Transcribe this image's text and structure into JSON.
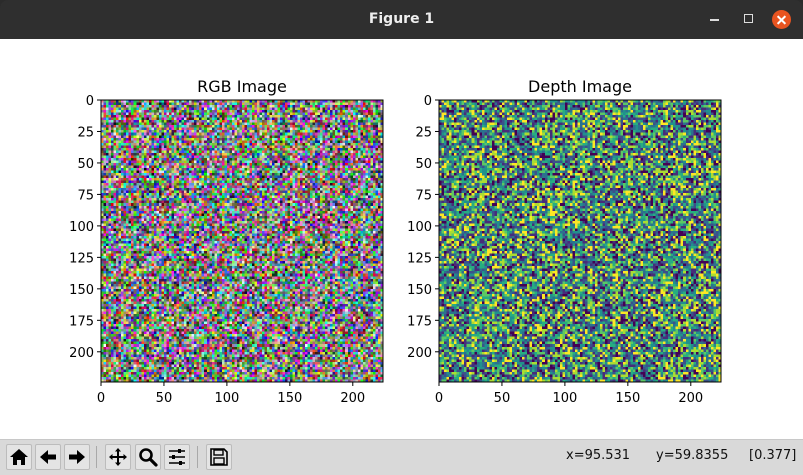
{
  "window": {
    "title": "Figure 1",
    "controls": [
      "minimize-icon",
      "maximize-icon",
      "close-icon"
    ]
  },
  "chart_data": [
    {
      "type": "heatmap",
      "title": "RGB Image",
      "xlabel": "",
      "ylabel": "",
      "xlim": [
        0,
        224
      ],
      "ylim": [
        224,
        0
      ],
      "x_ticks": [
        0,
        50,
        100,
        150,
        200
      ],
      "y_ticks": [
        0,
        25,
        50,
        75,
        100,
        125,
        150,
        175,
        200
      ],
      "content": "random RGB noise, 224x224 pixels"
    },
    {
      "type": "heatmap",
      "title": "Depth Image",
      "xlabel": "",
      "ylabel": "",
      "xlim": [
        0,
        224
      ],
      "ylim": [
        224,
        0
      ],
      "x_ticks": [
        0,
        50,
        100,
        150,
        200
      ],
      "y_ticks": [
        0,
        25,
        50,
        75,
        100,
        125,
        150,
        175,
        200
      ],
      "colormap": "viridis",
      "content": "random scalar noise, 224x224 pixels"
    }
  ],
  "toolbar": {
    "buttons": [
      {
        "name": "home-button",
        "icon": "home-icon"
      },
      {
        "name": "back-button",
        "icon": "arrow-left-icon"
      },
      {
        "name": "forward-button",
        "icon": "arrow-right-icon"
      },
      {
        "name": "pan-button",
        "icon": "move-icon"
      },
      {
        "name": "zoom-button",
        "icon": "magnifier-icon"
      },
      {
        "name": "configure-subplots-button",
        "icon": "sliders-icon"
      },
      {
        "name": "save-button",
        "icon": "floppy-disk-icon"
      }
    ],
    "status": {
      "x": "x=95.531",
      "y": "y=59.8355",
      "value": "[0.377]"
    }
  }
}
